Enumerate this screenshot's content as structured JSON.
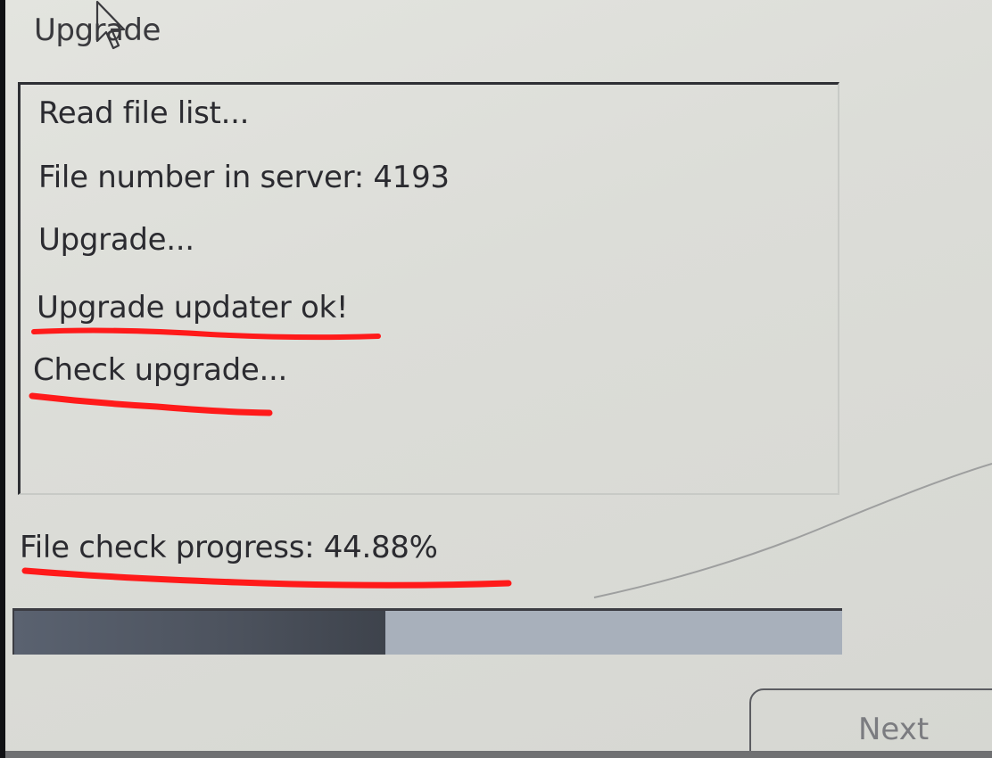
{
  "window": {
    "title": "Upgrade"
  },
  "log": {
    "lines": [
      "Read file list...",
      "File number in server: 4193",
      "Upgrade...",
      "Upgrade updater ok!",
      "Check upgrade..."
    ]
  },
  "progress": {
    "label": "File check progress: 44.88%",
    "fraction": 0.4488
  },
  "buttons": {
    "next_label": "Next"
  },
  "colors": {
    "annotation_red": "#ff1a1a",
    "progress_fill": "#4c525d",
    "progress_track": "#a8b0bb"
  },
  "icons": {
    "cursor": "mouse-pointer-icon"
  }
}
